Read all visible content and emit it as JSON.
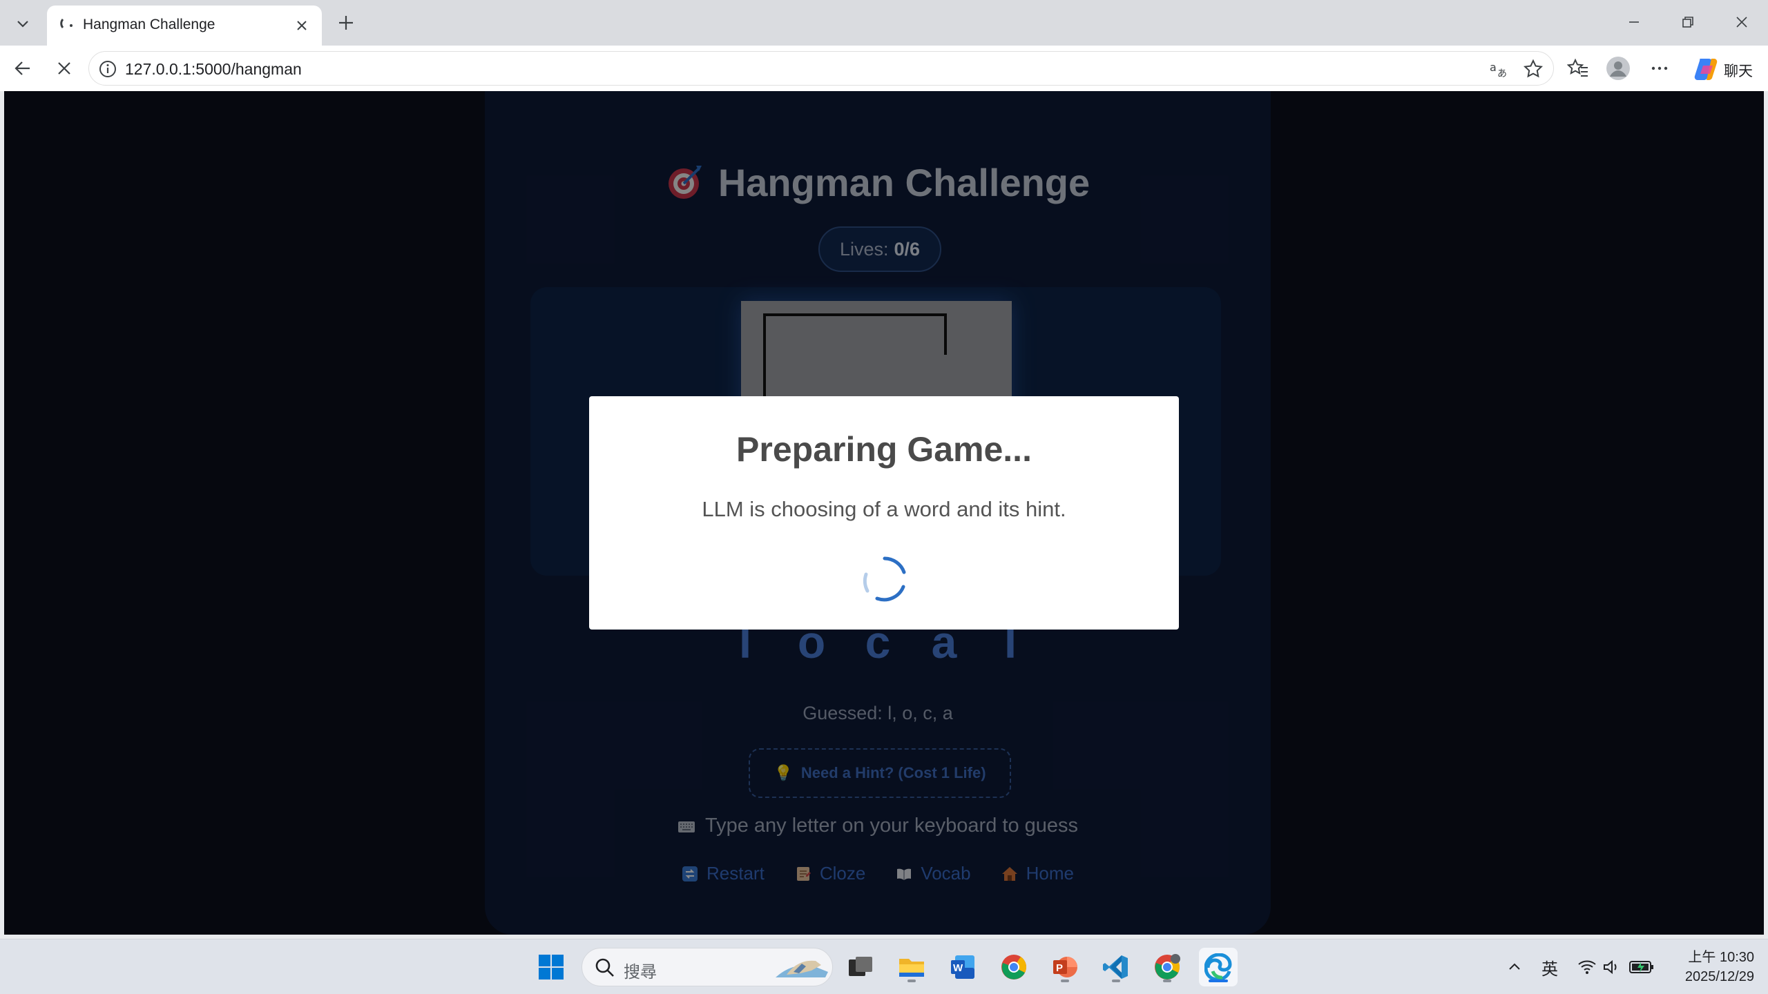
{
  "browser": {
    "tab_title": "Hangman Challenge",
    "url": "127.0.0.1:5000/hangman",
    "copilot_label": "聊天"
  },
  "game": {
    "title": "Hangman Challenge",
    "lives_label": "Lives:",
    "lives_value": "0/6",
    "word_letters": [
      "l",
      "o",
      "c",
      "a",
      "l"
    ],
    "guessed_text": "Guessed: l, o, c, a",
    "hint_button": "Need a Hint? (Cost 1 Life)",
    "keyboard_instruction": "Type any letter on your keyboard to guess",
    "nav": {
      "restart": "Restart",
      "cloze": "Cloze",
      "vocab": "Vocab",
      "home": "Home"
    }
  },
  "modal": {
    "title": "Preparing Game...",
    "message": "LLM is choosing of a word and its hint."
  },
  "taskbar": {
    "search_placeholder": "搜尋",
    "ime": "英",
    "time": "上午 10:30",
    "date": "2025/12/29"
  },
  "colors": {
    "page_bg": "#0b0f1c",
    "card_bg": "#0e1a38",
    "accent_blue": "#3a6cc8",
    "spinner": "#2c6fc4"
  }
}
